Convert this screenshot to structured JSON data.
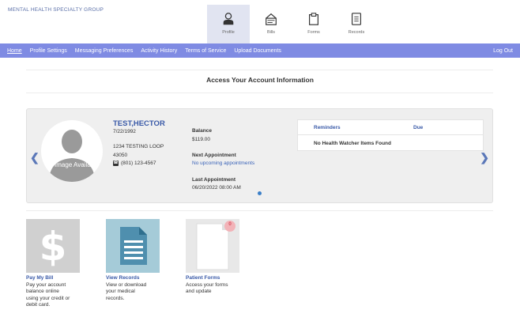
{
  "header": {
    "org_name": "MENTAL HEALTH SPECIALTY GROUP",
    "nav": [
      {
        "label": "Profile",
        "icon": "profile-icon",
        "active": true
      },
      {
        "label": "Bills",
        "icon": "bills-icon",
        "active": false
      },
      {
        "label": "Forms",
        "icon": "forms-icon",
        "active": false
      },
      {
        "label": "Records",
        "icon": "records-icon",
        "active": false
      }
    ]
  },
  "menu": {
    "items": [
      "Home",
      "Profile Settings",
      "Messaging Preferences",
      "Activity History",
      "Terms of Service",
      "Upload Documents"
    ],
    "logout": "Log Out",
    "color": "#7f8be3"
  },
  "main": {
    "title": "Access Your Account Information"
  },
  "patient": {
    "no_image": "No Image Available",
    "name": "TEST,HECTOR",
    "dob": "7/22/1992",
    "address_line1": "1234 TESTING LOOP",
    "address_line2": "43050",
    "phone": "(801) 123-4567",
    "balance_label": "Balance",
    "balance_value": "$119.00",
    "next_appt_label": "Next Appointment",
    "next_appt_value": "No upcoming appointments",
    "last_appt_label": "Last Appointment",
    "last_appt_value": "06/20/2022 08:00 AM"
  },
  "reminders": {
    "col_reminders": "Reminders",
    "col_due": "Due",
    "empty": "No Health Watcher Items Found"
  },
  "tiles": [
    {
      "title": "Pay My Bill",
      "lines": [
        "Pay your account",
        "balance online",
        "using your credit or",
        "debit card."
      ],
      "icon": "dollar-icon"
    },
    {
      "title": "View Records",
      "lines": [
        "View or download",
        "your medical",
        "records."
      ],
      "icon": "document-icon"
    },
    {
      "title": "Patient Forms",
      "lines": [
        "Access your forms",
        "and update"
      ],
      "icon": "form-icon",
      "badge": "0"
    }
  ],
  "colors": {
    "accent": "#3a5aa8",
    "link": "#3a63b8",
    "badge": "#f2b3b8"
  }
}
